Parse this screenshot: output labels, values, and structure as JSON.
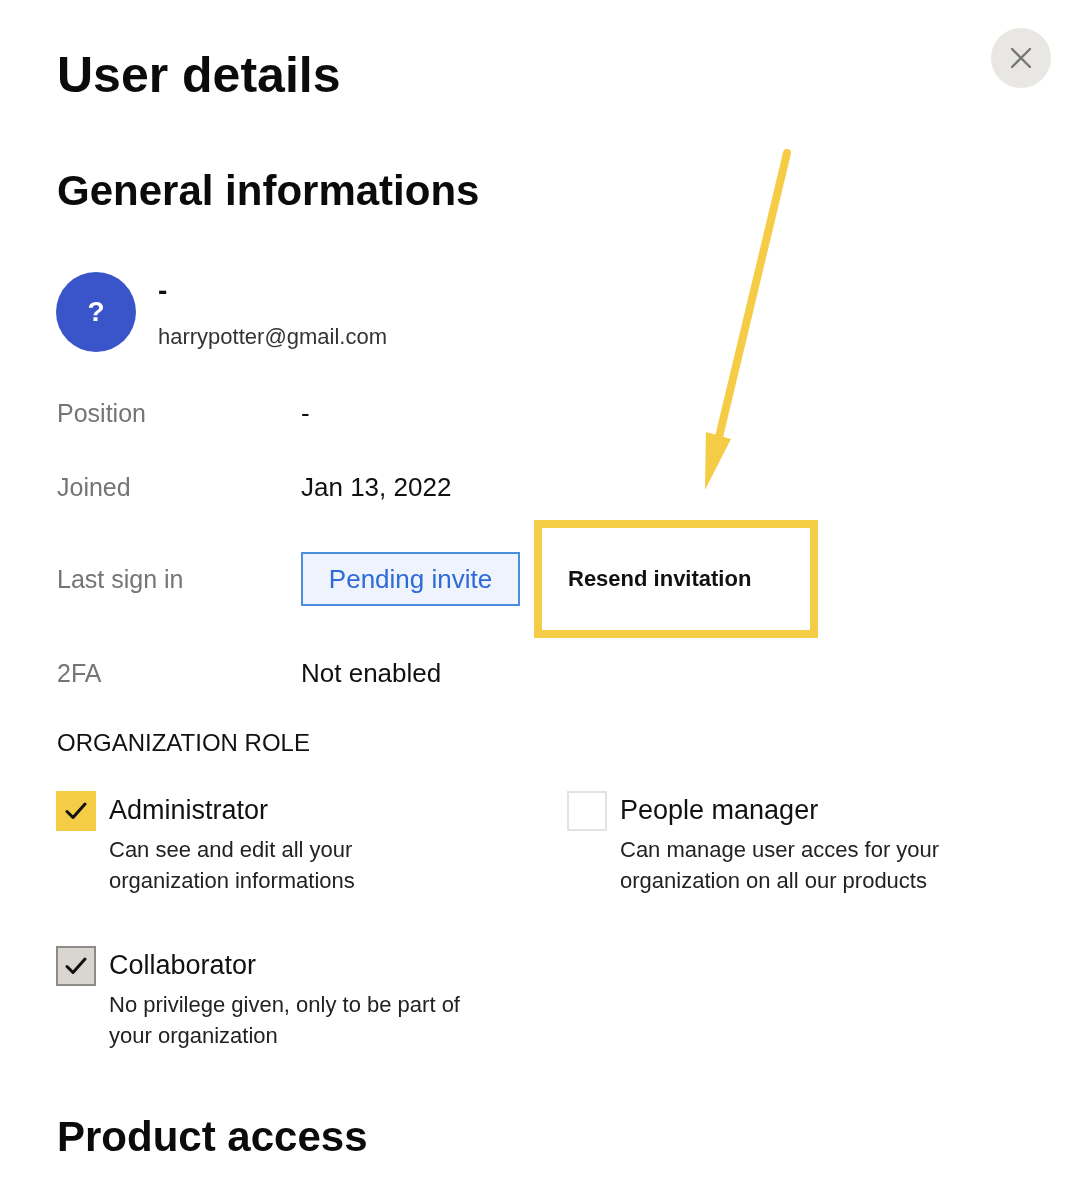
{
  "title": "User details",
  "general": {
    "heading": "General informations",
    "user": {
      "avatar": "?",
      "name": "-",
      "email": "harrypotter@gmail.com"
    },
    "fields": [
      {
        "label": "Position",
        "kind": "text",
        "value": "-"
      },
      {
        "label": "Joined",
        "kind": "text",
        "value": "Jan 13, 2022"
      },
      {
        "label": "Last sign in",
        "kind": "badge",
        "value": "Pending invite",
        "action": {
          "label": "Resend invitation",
          "highlighted": true
        }
      },
      {
        "label": "2FA",
        "kind": "text",
        "value": "Not enabled"
      }
    ]
  },
  "organization_role": {
    "heading": "ORGANIZATION ROLE",
    "roles": [
      {
        "label": "Administrator",
        "description": "Can see and edit all your\norganization informations",
        "checked": true,
        "disabled": false
      },
      {
        "label": "People manager",
        "description": "Can manage user acces for your\norganization on all our products",
        "checked": false,
        "disabled": false
      },
      {
        "label": "Collaborator",
        "description": "No privilege given, only to be part of\nyour organization",
        "checked": true,
        "disabled": true
      }
    ]
  },
  "product_access": {
    "heading": "Product access"
  }
}
